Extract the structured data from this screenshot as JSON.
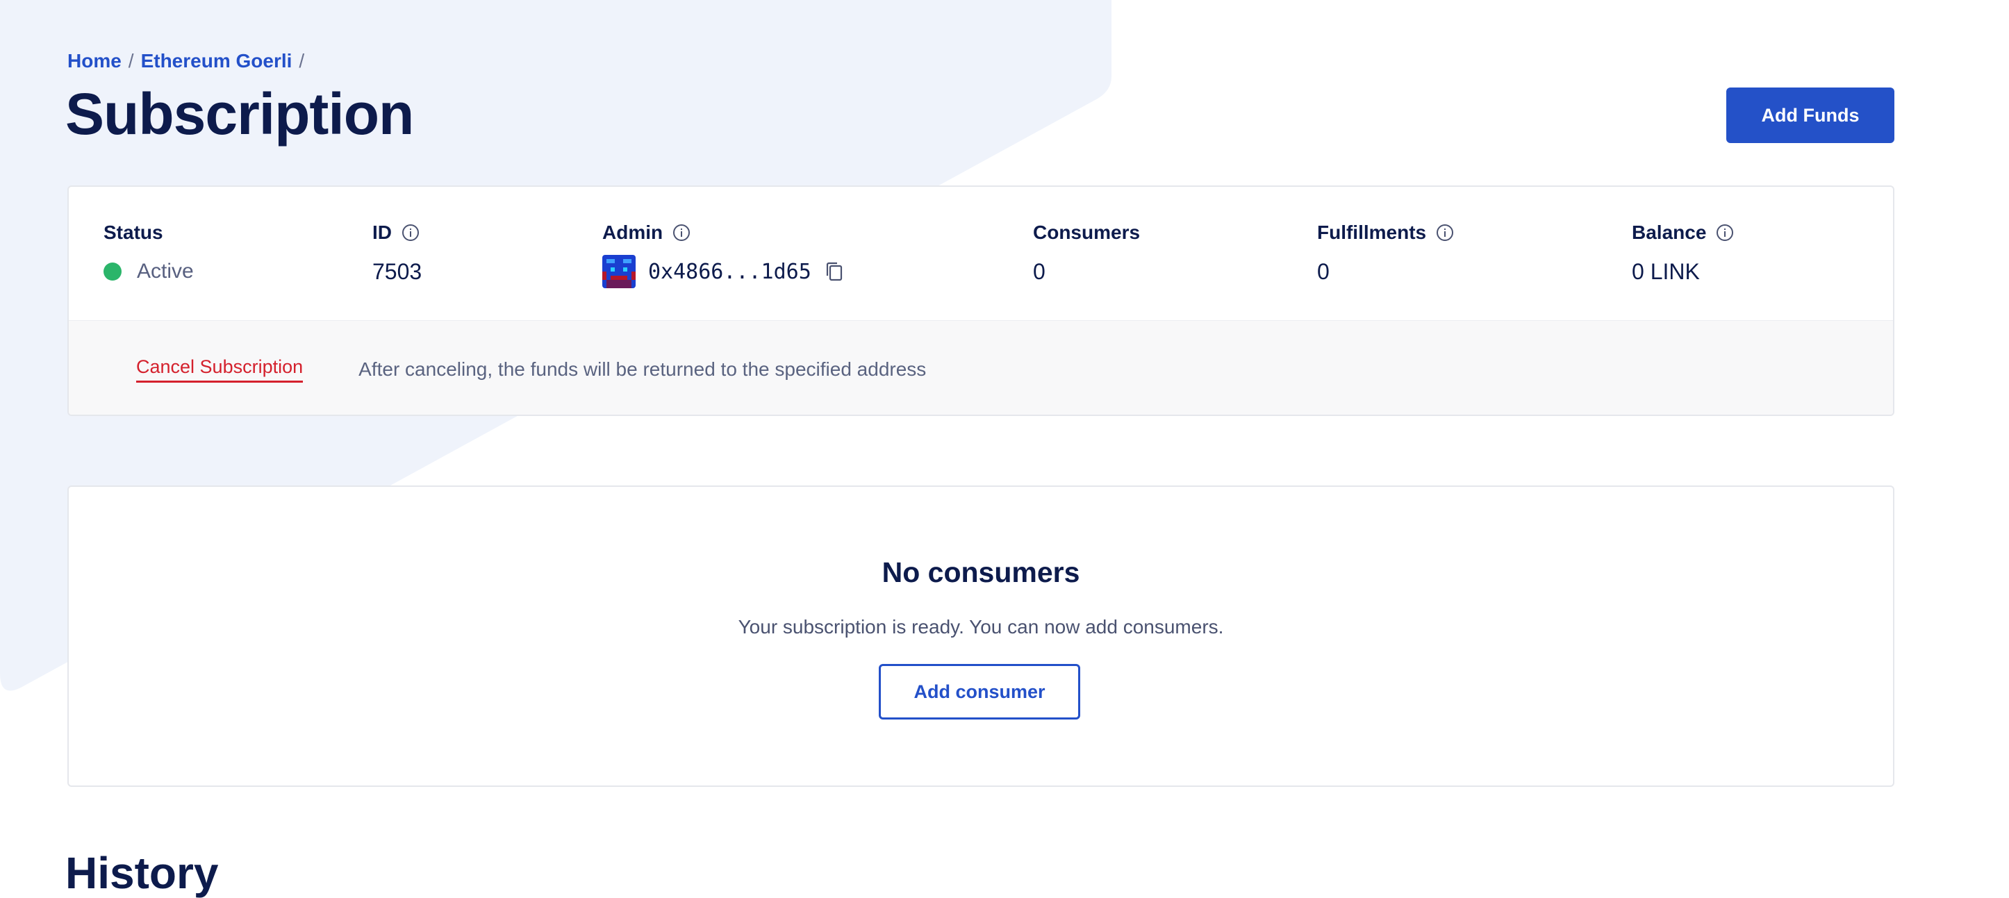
{
  "breadcrumb": {
    "items": [
      {
        "label": "Home"
      },
      {
        "label": "Ethereum Goerli"
      }
    ],
    "separator": "/"
  },
  "header": {
    "title": "Subscription",
    "add_funds_label": "Add Funds"
  },
  "details": {
    "status": {
      "label": "Status",
      "value": "Active",
      "color": "#2bb56a"
    },
    "id": {
      "label": "ID",
      "value": "7503",
      "info_icon": "info-icon"
    },
    "admin": {
      "label": "Admin",
      "value": "0x4866...1d65",
      "info_icon": "info-icon",
      "avatar_icon": "blockie-avatar",
      "copy_icon": "copy-icon"
    },
    "consumers": {
      "label": "Consumers",
      "value": "0"
    },
    "fulfillments": {
      "label": "Fulfillments",
      "value": "0",
      "info_icon": "info-icon"
    },
    "balance": {
      "label": "Balance",
      "value": "0 LINK",
      "info_icon": "info-icon"
    }
  },
  "footer": {
    "cancel_label": "Cancel Subscription",
    "cancel_note": "After canceling, the funds will be returned to the specified address"
  },
  "consumers_panel": {
    "title": "No consumers",
    "text": "Your subscription is ready. You can now add consumers.",
    "add_consumer_label": "Add consumer"
  },
  "history": {
    "heading": "History"
  },
  "colors": {
    "primary": "#2451c8",
    "navy": "#0d1b4c",
    "danger": "#d4212d",
    "background_shape": "#eff3fb"
  }
}
